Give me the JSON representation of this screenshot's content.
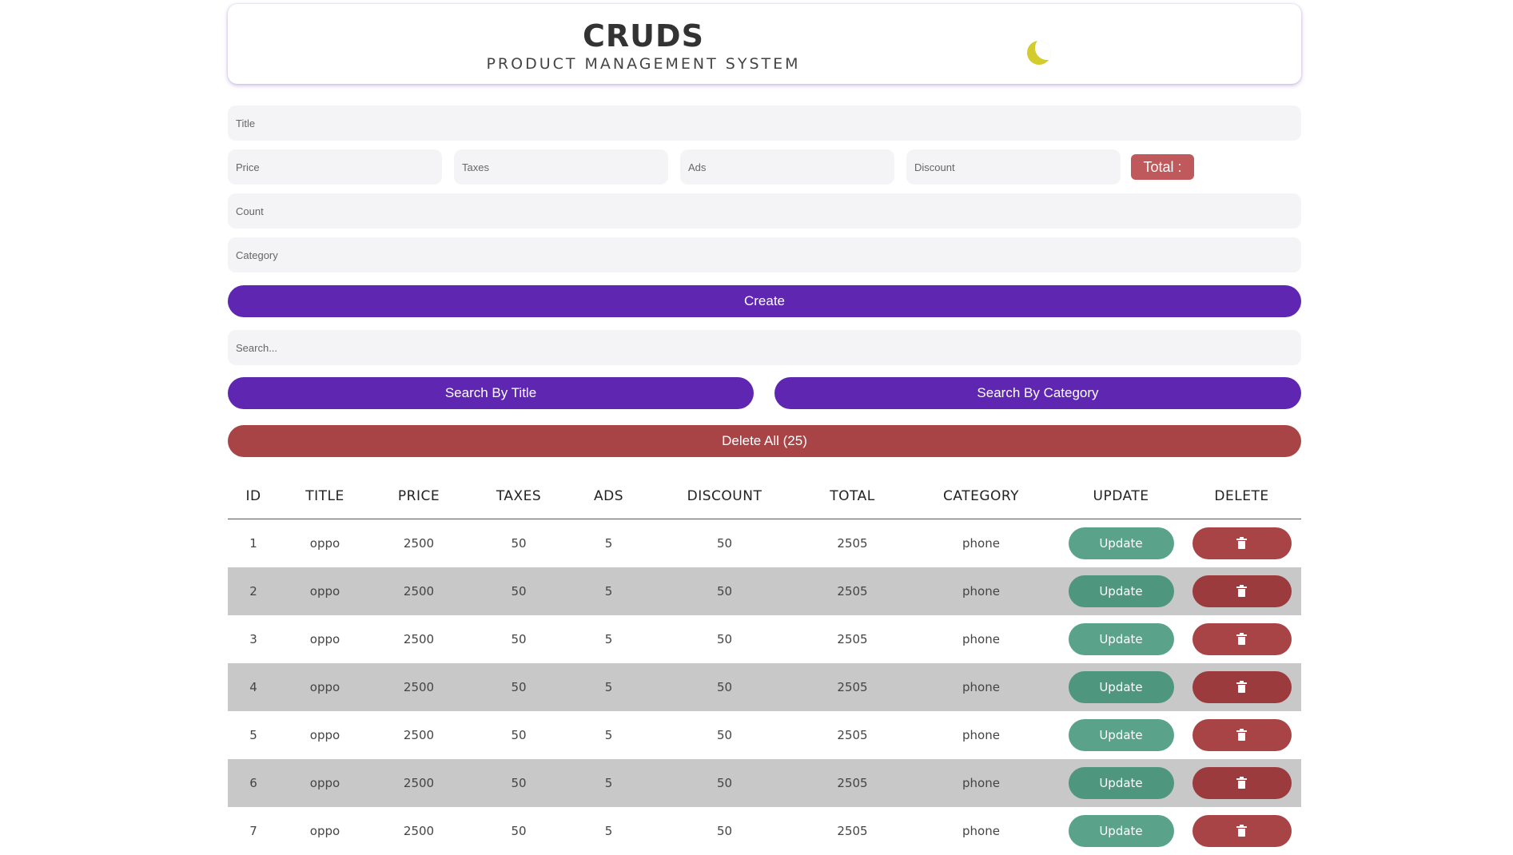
{
  "header": {
    "title": "CRUDS",
    "subtitle": "PRODUCT MANAGEMENT SYSTEM",
    "theme_icon": "moon-icon",
    "theme_icon_color": "#d4cc2c"
  },
  "form": {
    "title_placeholder": "Title",
    "price_placeholder": "Price",
    "taxes_placeholder": "Taxes",
    "ads_placeholder": "Ads",
    "discount_placeholder": "Discount",
    "total_label": "Total :",
    "count_placeholder": "Count",
    "category_placeholder": "Category",
    "create_label": "Create"
  },
  "search": {
    "placeholder": "Search...",
    "by_title_label": "Search By Title",
    "by_category_label": "Search By Category"
  },
  "delete_all_label": "Delete All (25)",
  "colors": {
    "primary": "#5f27b1",
    "danger": "#a94446",
    "update": "#5aa38a",
    "total_badge": "#c0595b"
  },
  "table": {
    "headers": [
      "ID",
      "TITLE",
      "PRICE",
      "TAXES",
      "ADS",
      "DISCOUNT",
      "TOTAL",
      "CATEGORY",
      "UPDATE",
      "DELETE"
    ],
    "update_label": "Update",
    "delete_icon": "trash-icon",
    "rows": [
      {
        "id": "1",
        "title": "oppo",
        "price": "2500",
        "taxes": "50",
        "ads": "5",
        "discount": "50",
        "total": "2505",
        "category": "phone"
      },
      {
        "id": "2",
        "title": "oppo",
        "price": "2500",
        "taxes": "50",
        "ads": "5",
        "discount": "50",
        "total": "2505",
        "category": "phone"
      },
      {
        "id": "3",
        "title": "oppo",
        "price": "2500",
        "taxes": "50",
        "ads": "5",
        "discount": "50",
        "total": "2505",
        "category": "phone"
      },
      {
        "id": "4",
        "title": "oppo",
        "price": "2500",
        "taxes": "50",
        "ads": "5",
        "discount": "50",
        "total": "2505",
        "category": "phone"
      },
      {
        "id": "5",
        "title": "oppo",
        "price": "2500",
        "taxes": "50",
        "ads": "5",
        "discount": "50",
        "total": "2505",
        "category": "phone"
      },
      {
        "id": "6",
        "title": "oppo",
        "price": "2500",
        "taxes": "50",
        "ads": "5",
        "discount": "50",
        "total": "2505",
        "category": "phone"
      },
      {
        "id": "7",
        "title": "oppo",
        "price": "2500",
        "taxes": "50",
        "ads": "5",
        "discount": "50",
        "total": "2505",
        "category": "phone"
      }
    ]
  }
}
